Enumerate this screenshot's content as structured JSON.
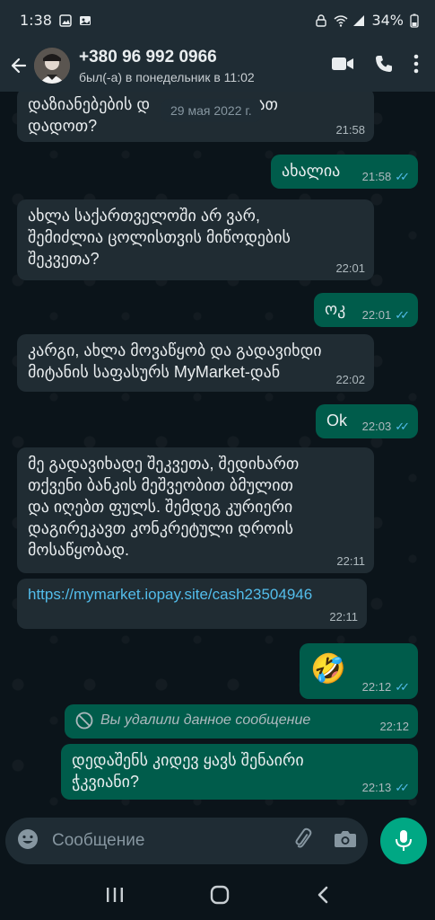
{
  "status_bar": {
    "time": "1:38",
    "battery": "34%"
  },
  "header": {
    "contact_name": "+380 96 992 0966",
    "last_seen": "был(-а) в понедельник в 11:02"
  },
  "date_chip": "29 мая 2022 г.",
  "messages": [
    {
      "dir": "in",
      "text_line1": "დაზიანებების დ",
      "text_line2": "დადოთ?",
      "hidden_tail": "იათ",
      "time": "21:58"
    },
    {
      "dir": "out",
      "text": "ახალია",
      "time": "21:58"
    },
    {
      "dir": "in",
      "lines": [
        "ახლა საქართველოში არ ვარ,",
        "შემიძლია ცოლისთვის მიწოდების",
        "შეკვეთა?"
      ],
      "time": "22:01"
    },
    {
      "dir": "out",
      "text": "ოკ",
      "time": "22:01"
    },
    {
      "dir": "in",
      "lines": [
        "კარგი, ახლა მოვაწყობ და გადავიხდი",
        "მიტანის საფასურს MyMarket-დან"
      ],
      "time": "22:02"
    },
    {
      "dir": "out",
      "text": "Ok",
      "time": "22:03"
    },
    {
      "dir": "in",
      "lines": [
        "მე გადავიხადე შეკვეთა, შედიხართ",
        "თქვენი ბანკის მეშვეობით ბმულით",
        "და იღებთ ფულს. შემდეგ კურიერი",
        "დაგირეკავთ კონკრეტული დროის",
        "მოსაწყობად."
      ],
      "time": "22:11"
    },
    {
      "dir": "in",
      "link": "https://mymarket.iopay.site/cash23504946",
      "time": "22:11"
    },
    {
      "dir": "out",
      "emoji": "🤣",
      "time": "22:12"
    },
    {
      "dir": "out",
      "deleted_text": "Вы удалили данное сообщение",
      "time": "22:12"
    },
    {
      "dir": "out",
      "lines": [
        "დედაშენს კიდევ ყავს შენაირი",
        "ჭკვიანი?"
      ],
      "time": "22:13"
    }
  ],
  "input": {
    "placeholder": "Сообщение"
  },
  "colors": {
    "background": "#0b141a",
    "header": "#1f2c34",
    "incoming_bubble": "#202c33",
    "outgoing_bubble": "#005c4b",
    "accent": "#00a884",
    "read_ticks": "#53bdeb"
  }
}
